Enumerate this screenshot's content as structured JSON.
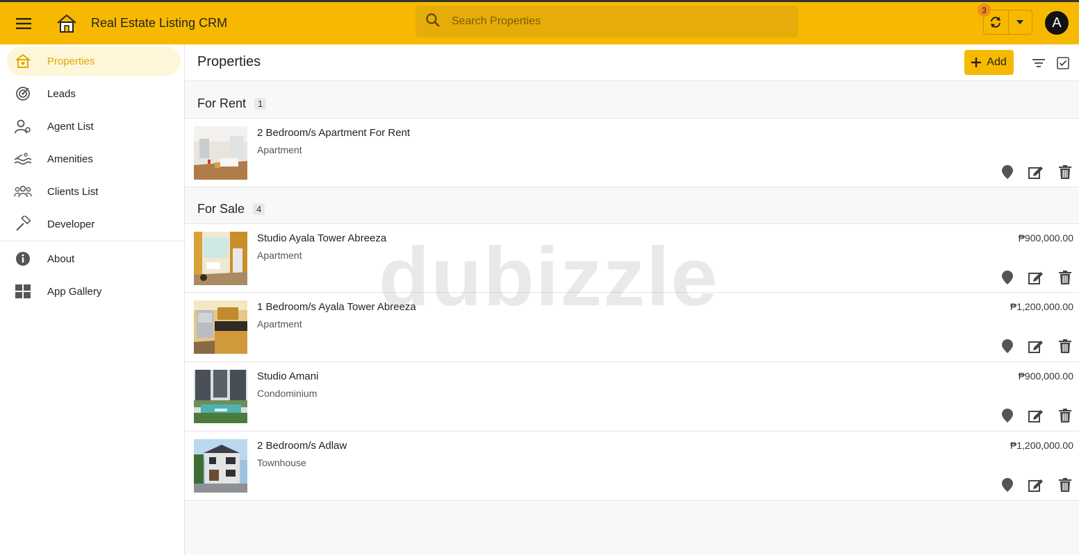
{
  "header": {
    "title": "Real Estate Listing CRM",
    "search_placeholder": "Search Properties",
    "badge_count": "3",
    "avatar_initial": "A"
  },
  "sidebar": {
    "items": [
      {
        "label": "Properties",
        "icon": "house-heart-icon",
        "active": true
      },
      {
        "label": "Leads",
        "icon": "target-icon"
      },
      {
        "label": "Agent List",
        "icon": "agent-icon"
      },
      {
        "label": "Amenities",
        "icon": "pool-icon"
      },
      {
        "label": "Clients List",
        "icon": "group-icon"
      },
      {
        "label": "Developer",
        "icon": "hammer-icon"
      },
      {
        "label": "About",
        "icon": "info-icon"
      },
      {
        "label": "App Gallery",
        "icon": "grid-icon"
      }
    ]
  },
  "main": {
    "title": "Properties",
    "add_label": "Add",
    "groups": [
      {
        "title": "For Rent",
        "count": "1",
        "items": [
          {
            "title": "2 Bedroom/s Apartment For Rent",
            "type": "Apartment",
            "price": ""
          }
        ]
      },
      {
        "title": "For Sale",
        "count": "4",
        "items": [
          {
            "title": "Studio Ayala Tower Abreeza",
            "type": "Apartment",
            "price": "₱900,000.00"
          },
          {
            "title": "1 Bedroom/s Ayala Tower Abreeza",
            "type": "Apartment",
            "price": "₱1,200,000.00"
          },
          {
            "title": "Studio Amani",
            "type": "Condominium",
            "price": "₱900,000.00"
          },
          {
            "title": "2 Bedroom/s Adlaw",
            "type": "Townhouse",
            "price": "₱1,200,000.00"
          }
        ]
      }
    ]
  },
  "watermark": "dubizzle",
  "colors": {
    "accent": "#f7b900",
    "active_text": "#e0a800"
  }
}
